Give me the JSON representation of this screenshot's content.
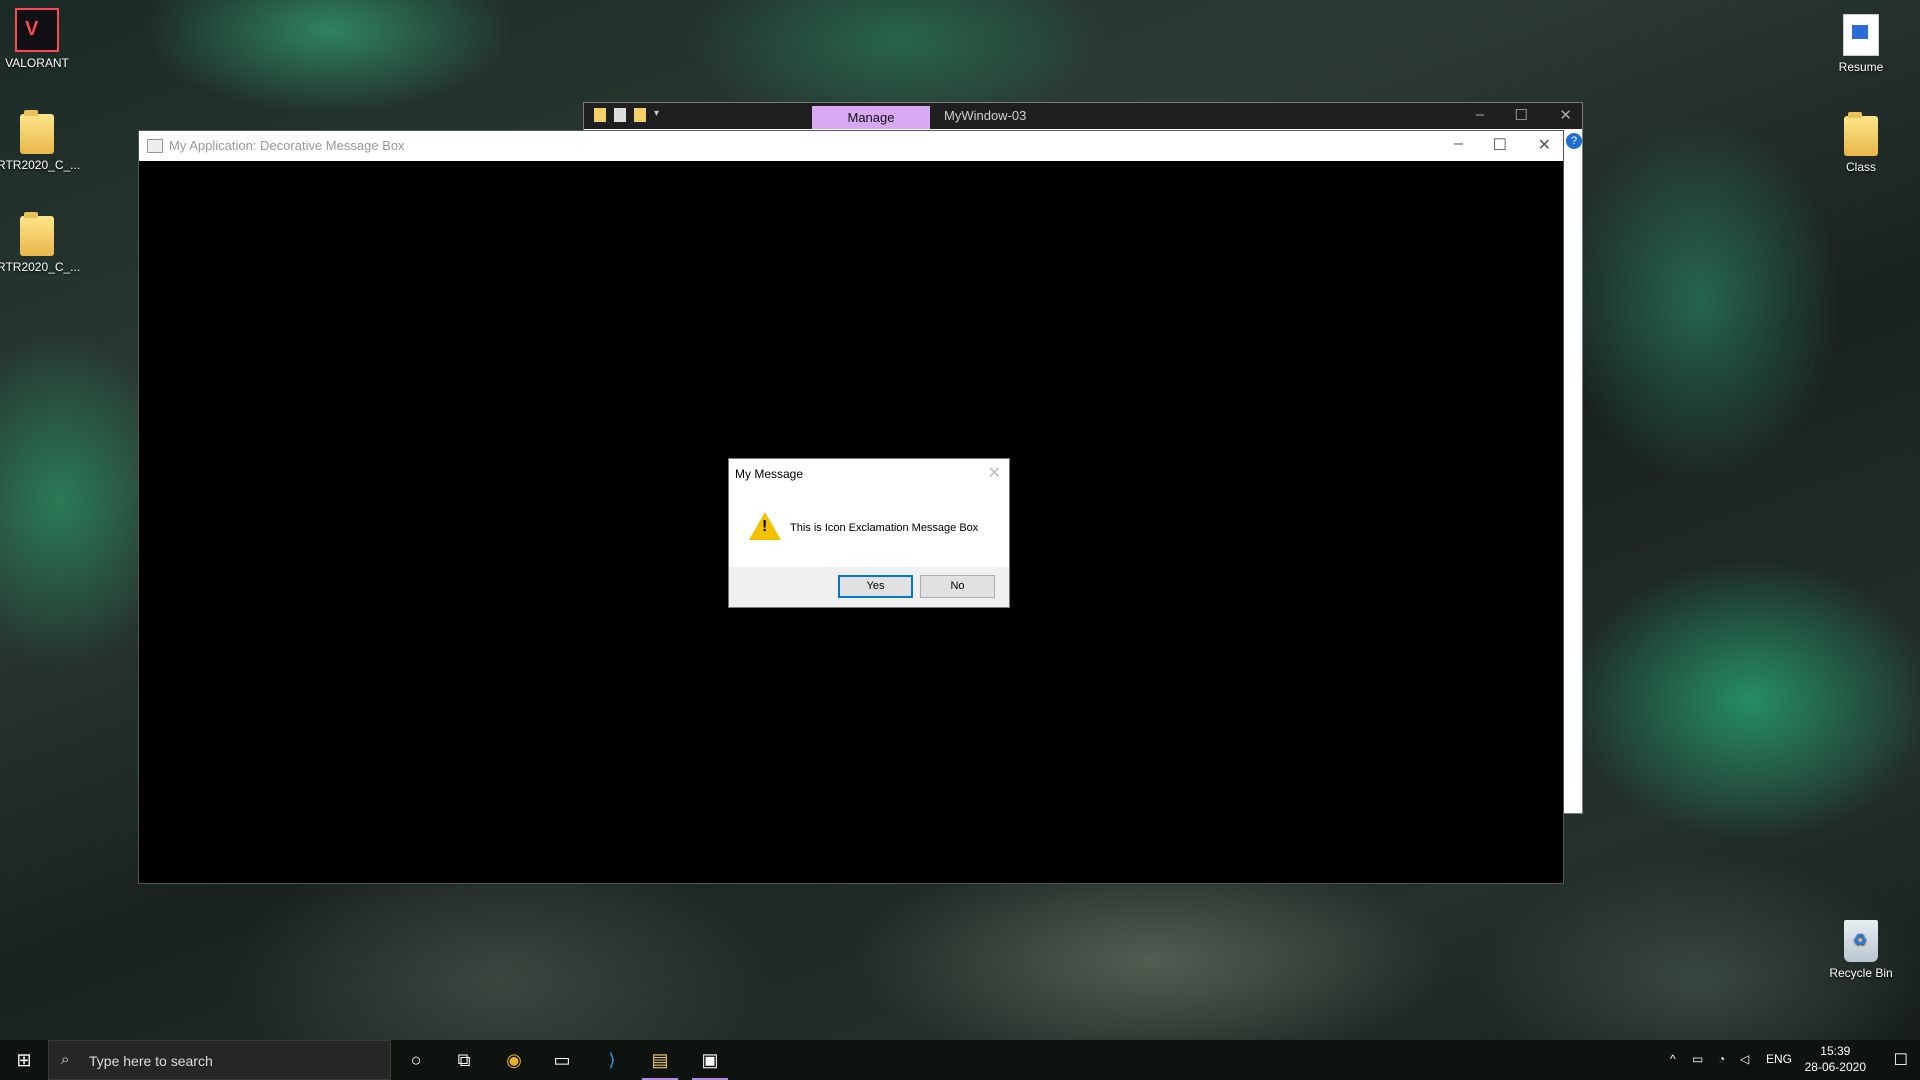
{
  "desktop": {
    "icons_left": [
      {
        "label": "VALORANT",
        "icon": "valorant-app-icon"
      },
      {
        "label": "RTR2020_C_...",
        "icon": "folder-icon"
      },
      {
        "label": "RTR2020_C_...",
        "icon": "folder-icon"
      }
    ],
    "icons_right": [
      {
        "label": "Resume",
        "icon": "document-icon"
      },
      {
        "label": "Class",
        "icon": "folder-icon"
      },
      {
        "label": "Recycle Bin",
        "icon": "recycle-bin-icon"
      }
    ]
  },
  "explorer": {
    "manage_tab": "Manage",
    "title": "MyWindow-03"
  },
  "app_window": {
    "title": "My Application: Decorative Message Box"
  },
  "message_box": {
    "title": "My Message",
    "text": "This is Icon Exclamation Message Box",
    "icon": "exclamation-warning-icon",
    "yes_label": "Yes",
    "no_label": "No"
  },
  "taskbar": {
    "search_placeholder": "Type here to search",
    "language": "ENG",
    "time": "15:39",
    "date": "28-06-2020"
  },
  "colors": {
    "accent": "#b08be0",
    "manage_tab": "#d8a8f5",
    "warning": "#f2c200"
  }
}
